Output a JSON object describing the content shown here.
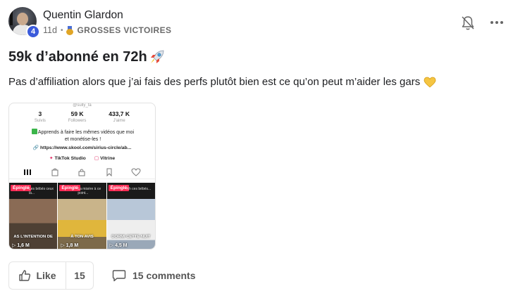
{
  "post": {
    "author": "Quentin Glardon",
    "level": "4",
    "time_ago": "11d",
    "separator": "•",
    "category": "GROSSES VICTOIRES",
    "title": "59k d’abonné en 72h",
    "body": "Pas d’affiliation alors que j’ai fais des perfs plutôt bien est ce qu’on peut m’aider les gars"
  },
  "screenshot": {
    "handle": "@sully_fa",
    "stats": [
      {
        "value": "3",
        "label": "Suivis"
      },
      {
        "value": "59 K",
        "label": "Followers"
      },
      {
        "value": "433,7 K",
        "label": "J'aime"
      }
    ],
    "bio_line1": "Apprends à faire les mêmes vidéos que moi",
    "bio_line2": "et monétise-les !",
    "link": "https://www.skool.com/sirius-circle/ab...",
    "studio_label": "TikTok Studio",
    "shop_label": "Vitrine",
    "videos": [
      {
        "pinned": "Épinglé",
        "small_caption": "Les bébés ceux là...",
        "caption": "AS L'INTENTION DE",
        "views": "1,6 M"
      },
      {
        "pinned": "Épinglé",
        "small_caption": "La misère à ce point...",
        "caption": "À TON AVIS",
        "views": "1,8 M"
      },
      {
        "pinned": "Épinglé",
        "small_caption": "Ah ces bébés...",
        "caption": "DORMI CETTE NUIT",
        "views": "4,5 M"
      }
    ]
  },
  "actions": {
    "like_label": "Like",
    "like_count": "15",
    "comments_label": "15 comments"
  },
  "icons": {
    "bell": "bell-off-icon",
    "more": "more-horizontal-icon",
    "like": "thumbs-up-icon",
    "comment": "comment-icon",
    "rocket": "rocket-emoji",
    "heart": "yellow-heart-emoji"
  }
}
